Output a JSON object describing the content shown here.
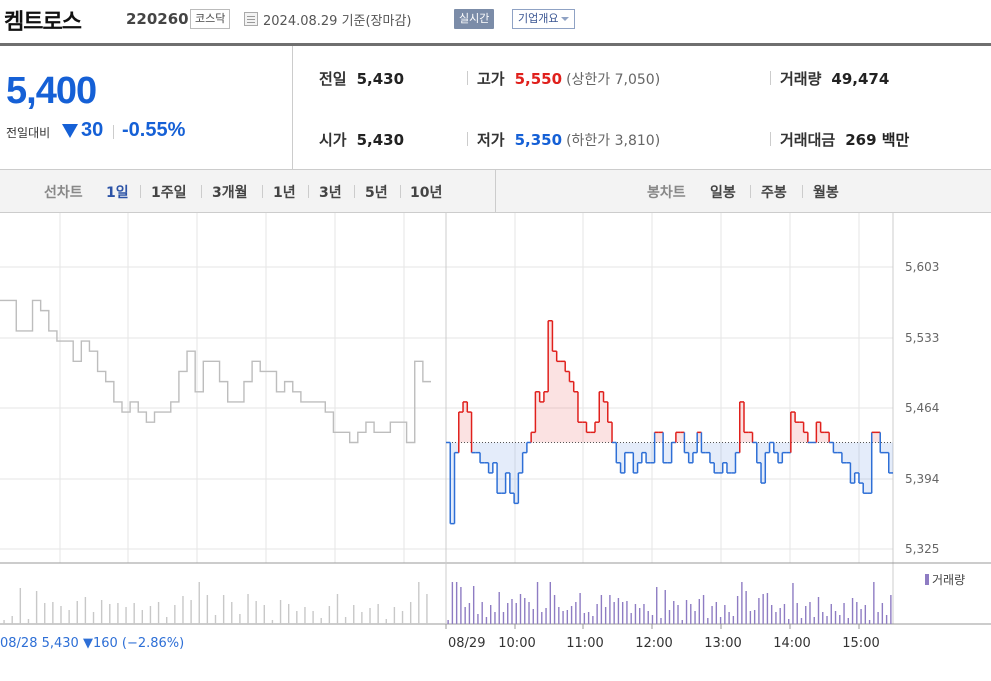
{
  "header": {
    "name": "켐트로스",
    "code": "220260",
    "market": "코스닥",
    "date": "2024.08.29  기준(장마감)",
    "realtime": "실시간",
    "company": "기업개요"
  },
  "quote": {
    "price": "5,400",
    "change_label": "전일대비",
    "change": "30",
    "change_pct": "-0.55%",
    "prev_label": "전일",
    "prev": "5,430",
    "open_label": "시가",
    "open": "5,430",
    "high_label": "고가",
    "high": "5,550",
    "upper_limit": "(상한가 7,050)",
    "low_label": "저가",
    "low": "5,350",
    "lower_limit": "(하한가 3,810)",
    "volume_label": "거래량",
    "volume": "49,474",
    "amount_label": "거래대금",
    "amount": "269 백만"
  },
  "tabs": {
    "line_label": "선차트",
    "periods": [
      "1일",
      "1주일",
      "3개월",
      "1년",
      "3년",
      "5년",
      "10년"
    ],
    "candle_label": "봉차트",
    "candles": [
      "일봉",
      "주봉",
      "월봉"
    ]
  },
  "chart_data": {
    "type": "line",
    "xlabel": "",
    "ylabel": "",
    "y_ticks": [
      "5,603",
      "5,533",
      "5,464",
      "5,394",
      "5,325"
    ],
    "y_tick_values": [
      5603,
      5533,
      5464,
      5394,
      5325
    ],
    "ylim": [
      5315,
      5620
    ],
    "x_ticks": [
      "08/29",
      "10:00",
      "11:00",
      "12:00",
      "13:00",
      "14:00",
      "15:00"
    ],
    "prev_close": 5430,
    "prev_day_summary": "08/28  5,430 ▼160 (−2.86%)",
    "volume_legend": "거래량",
    "colors": {
      "up": "#e0201c",
      "down": "#2e6fd6",
      "prev": "#bdbdbd",
      "volume": "#8e7cc3",
      "grid": "#e6e6e6"
    },
    "prev_day_series": [
      5570,
      5570,
      5540,
      5540,
      5570,
      5560,
      5540,
      5530,
      5530,
      5510,
      5530,
      5520,
      5500,
      5490,
      5470,
      5460,
      5470,
      5460,
      5450,
      5460,
      5460,
      5470,
      5500,
      5520,
      5480,
      5510,
      5510,
      5490,
      5470,
      5470,
      5490,
      5510,
      5500,
      5500,
      5480,
      5490,
      5480,
      5470,
      5470,
      5470,
      5460,
      5440,
      5440,
      5430,
      5440,
      5450,
      5440,
      5440,
      5450,
      5450,
      5430,
      5510,
      5490
    ],
    "today_series": [
      5430,
      5350,
      5420,
      5460,
      5470,
      5460,
      5420,
      5420,
      5410,
      5410,
      5400,
      5410,
      5380,
      5380,
      5400,
      5380,
      5370,
      5400,
      5420,
      5430,
      5440,
      5480,
      5470,
      5480,
      5550,
      5520,
      5510,
      5510,
      5500,
      5490,
      5480,
      5450,
      5450,
      5440,
      5440,
      5450,
      5480,
      5470,
      5450,
      5430,
      5410,
      5400,
      5420,
      5420,
      5400,
      5410,
      5420,
      5410,
      5410,
      5440,
      5440,
      5410,
      5410,
      5430,
      5440,
      5440,
      5420,
      5410,
      5420,
      5440,
      5420,
      5420,
      5410,
      5400,
      5400,
      5410,
      5400,
      5400,
      5420,
      5470,
      5440,
      5440,
      5430,
      5410,
      5390,
      5420,
      5430,
      5420,
      5410,
      5420,
      5420,
      5460,
      5450,
      5450,
      5440,
      5430,
      5430,
      5450,
      5440,
      5440,
      5430,
      5420,
      5420,
      5410,
      5410,
      5390,
      5400,
      5390,
      5380,
      5380,
      5440,
      5440,
      5420,
      5420,
      5400
    ]
  }
}
